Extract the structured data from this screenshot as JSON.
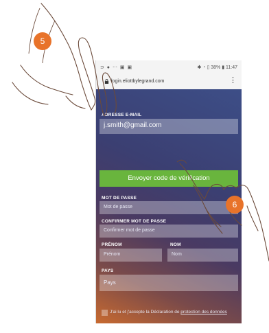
{
  "status_bar": {
    "left_icons": "⊃ ● ⋯ ▣ ▣",
    "right_text": "✱ ◔ ▯ 38% ▮ 11:47"
  },
  "browser": {
    "url": "login.eliottbylegrand.com",
    "menu_glyph": "⋮"
  },
  "form": {
    "email_label": "ADRESSE E-MAIL",
    "email_value": "j.smith@gmail.com",
    "send_code_button": "Envoyer code de vérification",
    "password_label": "MOT DE PASSE",
    "password_placeholder": "Mot de passe",
    "confirm_label": "CONFIRMER MOT DE PASSE",
    "confirm_placeholder": "Confirmer mot de passe",
    "firstname_label": "PRÉNOM",
    "firstname_placeholder": "Prénom",
    "lastname_label": "NOM",
    "lastname_placeholder": "Nom",
    "country_label": "PAYS",
    "country_placeholder": "Pays",
    "consent_text": "J'ai lu et j'accepte la Déclaration de ",
    "consent_link": "protection des données"
  },
  "callouts": {
    "step_a": "5",
    "step_b": "6"
  },
  "colors": {
    "accent_button": "#69b53d",
    "callout": "#e8732a"
  }
}
